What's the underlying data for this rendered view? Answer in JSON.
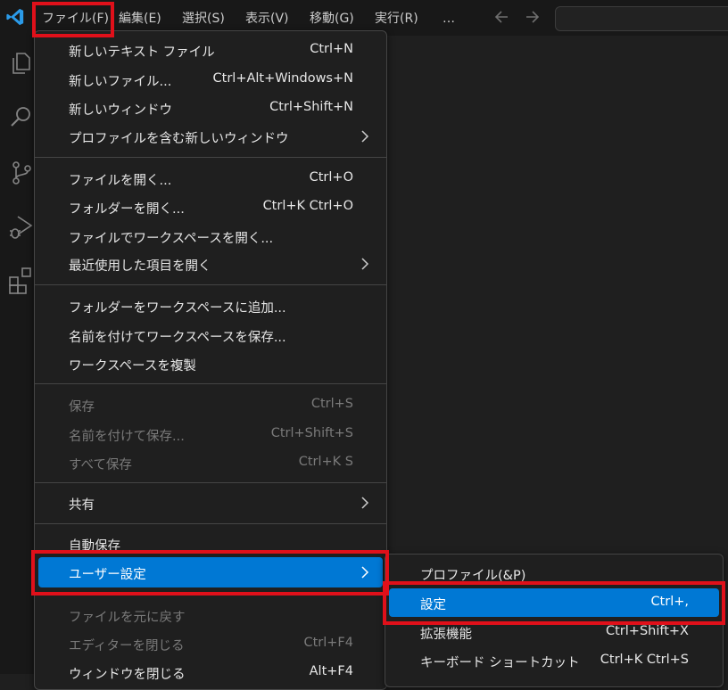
{
  "menubar": {
    "items": [
      "ファイル(F)",
      "編集(E)",
      "選択(S)",
      "表示(V)",
      "移動(G)",
      "実行(R)",
      "…"
    ]
  },
  "file_menu": {
    "groups": [
      [
        {
          "label": "新しいテキスト ファイル",
          "key": "Ctrl+N"
        },
        {
          "label": "新しいファイル...",
          "key": "Ctrl+Alt+Windows+N"
        },
        {
          "label": "新しいウィンドウ",
          "key": "Ctrl+Shift+N"
        },
        {
          "label": "プロファイルを含む新しいウィンドウ",
          "key": "",
          "submenu": true
        }
      ],
      [
        {
          "label": "ファイルを開く...",
          "key": "Ctrl+O"
        },
        {
          "label": "フォルダーを開く...",
          "key": "Ctrl+K Ctrl+O"
        },
        {
          "label": "ファイルでワークスペースを開く...",
          "key": ""
        },
        {
          "label": "最近使用した項目を開く",
          "key": "",
          "submenu": true
        }
      ],
      [
        {
          "label": "フォルダーをワークスペースに追加...",
          "key": ""
        },
        {
          "label": "名前を付けてワークスペースを保存...",
          "key": ""
        },
        {
          "label": "ワークスペースを複製",
          "key": ""
        }
      ],
      [
        {
          "label": "保存",
          "key": "Ctrl+S",
          "disabled": true
        },
        {
          "label": "名前を付けて保存...",
          "key": "Ctrl+Shift+S",
          "disabled": true
        },
        {
          "label": "すべて保存",
          "key": "Ctrl+K S",
          "disabled": true
        }
      ],
      [
        {
          "label": "共有",
          "key": "",
          "submenu": true
        }
      ],
      [
        {
          "label": "自動保存",
          "key": ""
        },
        {
          "label": "ユーザー設定",
          "key": "",
          "submenu": true,
          "highlighted": true
        }
      ],
      [
        {
          "label": "ファイルを元に戻す",
          "key": "",
          "disabled": true
        },
        {
          "label": "エディターを閉じる",
          "key": "Ctrl+F4",
          "disabled": true
        },
        {
          "label": "ウィンドウを閉じる",
          "key": "Alt+F4"
        }
      ]
    ]
  },
  "preferences_submenu": {
    "items": [
      {
        "label": "プロファイル(&P)",
        "key": ""
      },
      {
        "label": "設定",
        "key": "Ctrl+,",
        "highlighted": true
      },
      {
        "label": "拡張機能",
        "key": "Ctrl+Shift+X"
      },
      {
        "label": "キーボード ショートカット",
        "key": "Ctrl+K Ctrl+S"
      }
    ]
  },
  "icons": {
    "logo": "vscode-logo",
    "activity": [
      "explorer-icon",
      "search-icon",
      "source-control-icon",
      "run-debug-icon",
      "extensions-icon"
    ],
    "nav": [
      "arrow-left-icon",
      "arrow-right-icon"
    ]
  },
  "colors": {
    "highlight": "#0078d4",
    "annotation": "#e0101a",
    "background": "#1f1f1f"
  }
}
